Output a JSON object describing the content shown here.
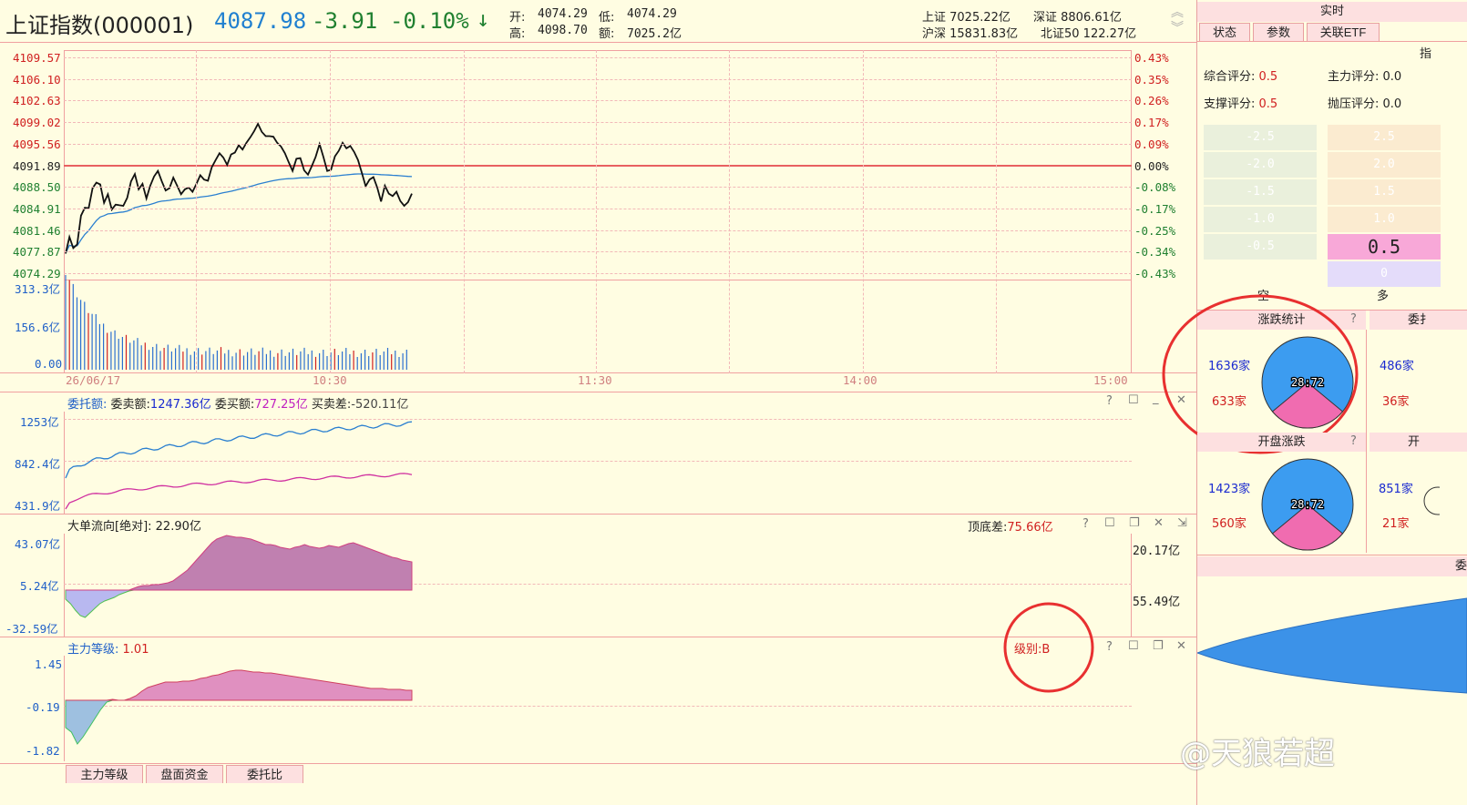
{
  "header": {
    "title": "上证指数(000001)",
    "price": "4087.98",
    "change": "-3.91",
    "change_pct": "-0.10%",
    "open_label": "开:",
    "open": "4074.29",
    "low_label": "低:",
    "low": "4074.29",
    "high_label": "高:",
    "high": "4098.70",
    "amount_label": "额:",
    "amount": "7025.2亿",
    "markets": [
      "上证 7025.22亿",
      "深证 8806.61亿",
      "沪深 15831.83亿",
      "北证50 122.27亿"
    ]
  },
  "price_axis": {
    "left": [
      "4109.57",
      "4106.10",
      "4102.63",
      "4099.02",
      "4095.56",
      "4091.89",
      "4088.50",
      "4084.91",
      "4081.46",
      "4077.87",
      "4074.29"
    ],
    "right": [
      "0.43%",
      "0.35%",
      "0.26%",
      "0.17%",
      "0.09%",
      "0.00%",
      "-0.08%",
      "-0.17%",
      "-0.25%",
      "-0.34%",
      "-0.43%"
    ],
    "base": "4091.89"
  },
  "volume": {
    "labels": [
      "313.3亿",
      "156.6亿",
      "0.00"
    ]
  },
  "time_labels": [
    "26/06/17",
    "10:30",
    "11:30",
    "14:00",
    "15:00"
  ],
  "orders": {
    "title": "委托额:",
    "sell_label": "委卖额:",
    "sell_value": "1247.36亿",
    "buy_label": " 委买额:",
    "buy_value": "727.25亿",
    "diff_label": " 买卖差:",
    "diff_value": "-520.11亿",
    "axis": [
      "1253亿",
      "842.4亿",
      "431.9亿"
    ]
  },
  "bigflow": {
    "title": "大单流向[绝对]: ",
    "value": "22.90亿",
    "peak_label": "顶底差:",
    "peak_value": "75.66亿",
    "axis": [
      "43.07亿",
      "5.24亿",
      "-32.59亿"
    ],
    "right": [
      "20.17亿",
      "55.49亿"
    ]
  },
  "mainforce": {
    "title": "主力等级: ",
    "value": "1.01",
    "level": "级别:B",
    "axis": [
      "1.45",
      "-0.19",
      "-1.82"
    ]
  },
  "bottom_tabs": [
    "主力等级",
    "盘面资金",
    "委托比"
  ],
  "right": {
    "header": "实时",
    "tabs": [
      "状态",
      "参数",
      "关联ETF"
    ],
    "cut_header": "指",
    "scores": [
      {
        "label": "综合评分:",
        "value": "0.5"
      },
      {
        "label": "主力评分:",
        "value": "0.0"
      },
      {
        "label": "支撑评分:",
        "value": "0.5"
      },
      {
        "label": "抛压评分:",
        "value": "0.0"
      }
    ],
    "left_scale": [
      "-2.5",
      "-2.0",
      "-1.5",
      "-1.0",
      "-0.5"
    ],
    "right_scale": [
      "2.5",
      "2.0",
      "1.5",
      "1.0",
      "0.5",
      "0"
    ],
    "highlight_value": "0.5",
    "short_label": "空",
    "long_label": "多",
    "rise_fall": {
      "title": "涨跌统计",
      "up": "1636家",
      "down": "633家",
      "ratio": "28:72"
    },
    "order_stats_cut": "委扌",
    "order_stats": {
      "up": "486家",
      "down": "36家"
    },
    "open_rise_fall": {
      "title": "开盘涨跌",
      "up": "1423家",
      "down": "560家",
      "ratio": "28:72"
    },
    "open_cut": "开",
    "open_stats": {
      "up": "851家",
      "down": "21家"
    },
    "bottom_cut": "委",
    "pie": {
      "up_color": "#3c9cf0",
      "down_color": "#f06cb0",
      "down_fraction": 0.28
    }
  },
  "watermark": "@天狼若超",
  "colors": {
    "price_line": "#111111",
    "avg_line": "#2a7fd0",
    "up": "#d02020",
    "down": "#208030",
    "grid": "#f0a0a0"
  },
  "series": {
    "price": [
      4077.5,
      4080.2,
      4078.4,
      4079.0,
      4083.7,
      4085.0,
      4084.9,
      4088.2,
      4089.1,
      4088.8,
      4085.8,
      4087.2,
      4084.7,
      4085.5,
      4085.4,
      4085.3,
      4086.6,
      4089.3,
      4090.5,
      4088.0,
      4088.9,
      4086.5,
      4088.6,
      4090.1,
      4091.0,
      4089.3,
      4087.8,
      4088.2,
      4089.9,
      4088.6,
      4087.2,
      4088.0,
      4088.3,
      4087.6,
      4088.9,
      4090.3,
      4089.6,
      4089.4,
      4091.6,
      4092.8,
      4093.9,
      4093.2,
      4092.0,
      4093.7,
      4094.0,
      4095.2,
      4094.5,
      4095.6,
      4096.5,
      4097.5,
      4098.7,
      4097.4,
      4096.7,
      4096.7,
      4096.6,
      4095.6,
      4095.0,
      4093.9,
      4092.4,
      4091.0,
      4093.0,
      4093.1,
      4091.1,
      4090.4,
      4091.8,
      4093.3,
      4095.4,
      4093.3,
      4091.0,
      4091.2,
      4093.4,
      4094.3,
      4095.6,
      4094.7,
      4095.1,
      4094.1,
      4092.8,
      4090.7,
      4088.5,
      4089.6,
      4090.0,
      4088.3,
      4086.0,
      4088.6,
      4087.3,
      4086.9,
      4087.6,
      4086.1,
      4085.3,
      4085.9,
      4087.3
    ]
  }
}
